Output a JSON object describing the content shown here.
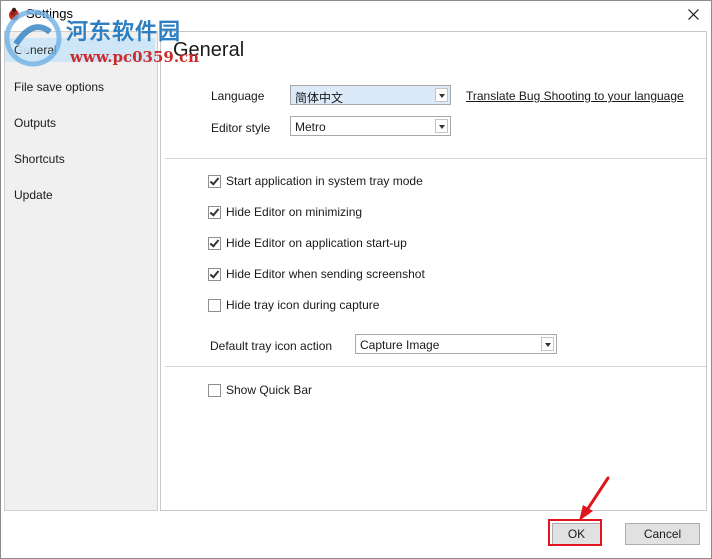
{
  "window": {
    "title": "Settings",
    "close_glyph": "✕"
  },
  "watermark": {
    "line1": "河东软件园",
    "line2": "www.pc0359.cn"
  },
  "sidebar": {
    "items": [
      {
        "label": "General"
      },
      {
        "label": "File save options"
      },
      {
        "label": "Outputs"
      },
      {
        "label": "Shortcuts"
      },
      {
        "label": "Update"
      }
    ]
  },
  "content": {
    "heading": "General",
    "language": {
      "label": "Language",
      "value": "简体中文",
      "translate_link": "Translate Bug Shooting to your language"
    },
    "editor_style": {
      "label": "Editor style",
      "value": "Metro"
    },
    "checkboxes": [
      {
        "label": "Start application in system tray mode",
        "checked": true
      },
      {
        "label": "Hide Editor on minimizing",
        "checked": true
      },
      {
        "label": "Hide Editor on application start-up",
        "checked": true
      },
      {
        "label": "Hide Editor when sending screenshot",
        "checked": true
      },
      {
        "label": "Hide tray icon during capture",
        "checked": false
      }
    ],
    "tray_action": {
      "label": "Default tray icon action",
      "value": "Capture Image"
    },
    "quick_bar": {
      "label": "Show Quick Bar",
      "checked": false
    }
  },
  "buttons": {
    "ok": "OK",
    "cancel": "Cancel"
  },
  "colors": {
    "highlight": "#e0141e",
    "sidebar_selected": "#cfe6f7",
    "watermark_blue": "#2e7fc2",
    "watermark_red": "#cc2a2a"
  }
}
